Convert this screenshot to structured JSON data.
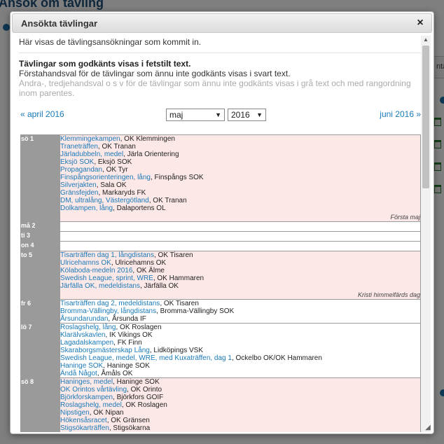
{
  "background": {
    "title": "Ansök om tävling",
    "tab_fragment": "nta"
  },
  "dialog": {
    "title": "Ansökta tävlingar",
    "close_label": "×",
    "intro": "Här visas de tävlingsansökningar som kommit in.",
    "legend_bold": "Tävlingar som godkänts visas i fetstilt text.",
    "legend_normal": "Förstahandsval för de tävlingar som ännu inte godkänts visas i svart text.",
    "legend_grey": "Andra-, tredjehandsval o s v för de tävlingar som ännu inte godkänts visas i grå text och med rangordning inom parentes.",
    "nav": {
      "prev": "« april 2016",
      "next": "juni 2016 »",
      "month_selected": "maj",
      "year_selected": "2016"
    }
  },
  "calendar": [
    {
      "day": "sö 1",
      "color": "pink",
      "events": [
        {
          "links": [
            "Klemmingekampen"
          ],
          "org": ", OK Klemmingen"
        },
        {
          "links": [
            "Traneträffen"
          ],
          "org": ", OK Tranan"
        },
        {
          "links": [
            "Järladubbeln, medel"
          ],
          "org": ", Järla Orientering"
        },
        {
          "links": [
            "Eksjö SOK"
          ],
          "org": ", Eksjö SOK"
        },
        {
          "links": [
            "Propagandan"
          ],
          "org": ", OK Tyr"
        },
        {
          "links": [
            "Finspångsorienteringen, lång"
          ],
          "org": ", Finspångs SOK"
        },
        {
          "links": [
            "Silverjakten"
          ],
          "org": ", Sala OK"
        },
        {
          "links": [
            "Gränsfejden"
          ],
          "org": ", Markaryds FK"
        },
        {
          "links": [
            "DM, ultralång, Västergötland"
          ],
          "org": ", OK Tranan"
        },
        {
          "links": [
            "Dolkampen, lång"
          ],
          "org": ", Dalaportens OL"
        }
      ],
      "holiday": "Första maj"
    },
    {
      "day": "må 2",
      "color": "white",
      "events": [],
      "holiday": ""
    },
    {
      "day": "ti 3",
      "color": "white",
      "events": [],
      "holiday": ""
    },
    {
      "day": "on 4",
      "color": "white",
      "events": [],
      "holiday": ""
    },
    {
      "day": "to 5",
      "color": "pink",
      "events": [
        {
          "links": [
            "Tisarträffen dag 1, långdistans"
          ],
          "org": ", OK Tisaren"
        },
        {
          "links": [
            "Ulricehamns OK"
          ],
          "org": ", Ulricehamns OK"
        },
        {
          "links": [
            "Kölaboda-medeln 2016"
          ],
          "org": ", OK Älme"
        },
        {
          "links": [
            "Swedish League, sprint, WRE"
          ],
          "org": ", OK Hammaren"
        },
        {
          "links": [
            "Järfälla OK, medeldistans"
          ],
          "org": ", Järfälla OK"
        }
      ],
      "holiday": "Kristi himmelfärds dag"
    },
    {
      "day": "fr 6",
      "color": "white",
      "events": [
        {
          "links": [
            "Tisarträffen dag 2, medeldistans"
          ],
          "org": ", OK Tisaren"
        },
        {
          "links": [
            "Bromma-Vällingby, långdistans"
          ],
          "org": ", Bromma-Vällingby SOK"
        },
        {
          "links": [
            "Årsundarundan"
          ],
          "org": ", Årsunda IF"
        }
      ],
      "holiday": ""
    },
    {
      "day": "lö 7",
      "color": "white",
      "events": [
        {
          "links": [
            "Roslagshelg, lång"
          ],
          "org": ", OK Roslagen"
        },
        {
          "links": [
            "Klarälvskavlen"
          ],
          "org": ", IK Vikings OK"
        },
        {
          "links": [
            "Lagadalskampen"
          ],
          "org": ", FK Finn"
        },
        {
          "links": [
            "Skaraborgsmästerskap Lång"
          ],
          "org": ", Lidköpings VSK"
        },
        {
          "links": [
            "Swedish League, medel, WRE, med Kuxaträffen, dag 1"
          ],
          "org": ", Ockelbo OK/OK Hammaren"
        },
        {
          "links": [
            "Haninge SOK"
          ],
          "org": ", Haninge SOK"
        },
        {
          "links": [
            "Ändå Något"
          ],
          "org": ", Åmåls OK"
        }
      ],
      "holiday": ""
    },
    {
      "day": "sö 8",
      "color": "pink",
      "events": [
        {
          "links": [
            "Haninges, medel"
          ],
          "org": ", Haninge SOK"
        },
        {
          "links": [
            "OK Orintos vårtävling"
          ],
          "org": ", OK Orinto"
        },
        {
          "links": [
            "Björkforskampen"
          ],
          "org": ", Björkfors GOIF"
        },
        {
          "links": [
            "Roslagshelg, medel"
          ],
          "org": ", OK Roslagen"
        },
        {
          "links": [
            "Nipstigen"
          ],
          "org": ", OK Nipan"
        },
        {
          "links": [
            "Hökensåsracet"
          ],
          "org": ", OK Gränsen"
        },
        {
          "links": [
            "Stigsökarträffen"
          ],
          "org": ", Stigsökarna"
        }
      ],
      "holiday": ""
    }
  ]
}
